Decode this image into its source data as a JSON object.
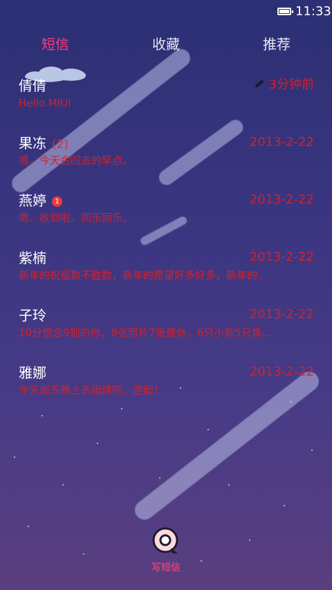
{
  "status_bar": {
    "time": "11:33",
    "battery_icon": "battery-full-icon"
  },
  "tabs": [
    {
      "label": "短信",
      "active": true
    },
    {
      "label": "收藏",
      "active": false
    },
    {
      "label": "推荐",
      "active": false
    }
  ],
  "conversations": [
    {
      "name": "倩倩",
      "time": "3分钟前",
      "preview": "Hello MIUI",
      "has_edit_icon": true
    },
    {
      "name": "果冻",
      "count": "(2)",
      "time": "2013-2-22",
      "preview": "嗯，今天会回去的早点。"
    },
    {
      "name": "燕婷",
      "unread": "1",
      "time": "2013-2-22",
      "preview": "嗯。收到啦。同乐同乐。"
    },
    {
      "name": "紫楠",
      "time": "2013-2-22",
      "preview": "新年的祝福数不胜数，新年的愿望好多好多，新年的..."
    },
    {
      "name": "子玲",
      "time": "2013-2-22",
      "preview": "10分想念9别的你，8张照片7张是你，6只小狗5只像..."
    },
    {
      "name": "雅娜",
      "time": "2013-2-22",
      "preview": "今天周五晚上去团建吧，走起！"
    }
  ],
  "compose": {
    "label": "写短信",
    "icon": "compose-message-icon"
  },
  "colors": {
    "accent_pink": "#ff3a78",
    "message_red": "#d4202a",
    "background": "#3a3580"
  }
}
